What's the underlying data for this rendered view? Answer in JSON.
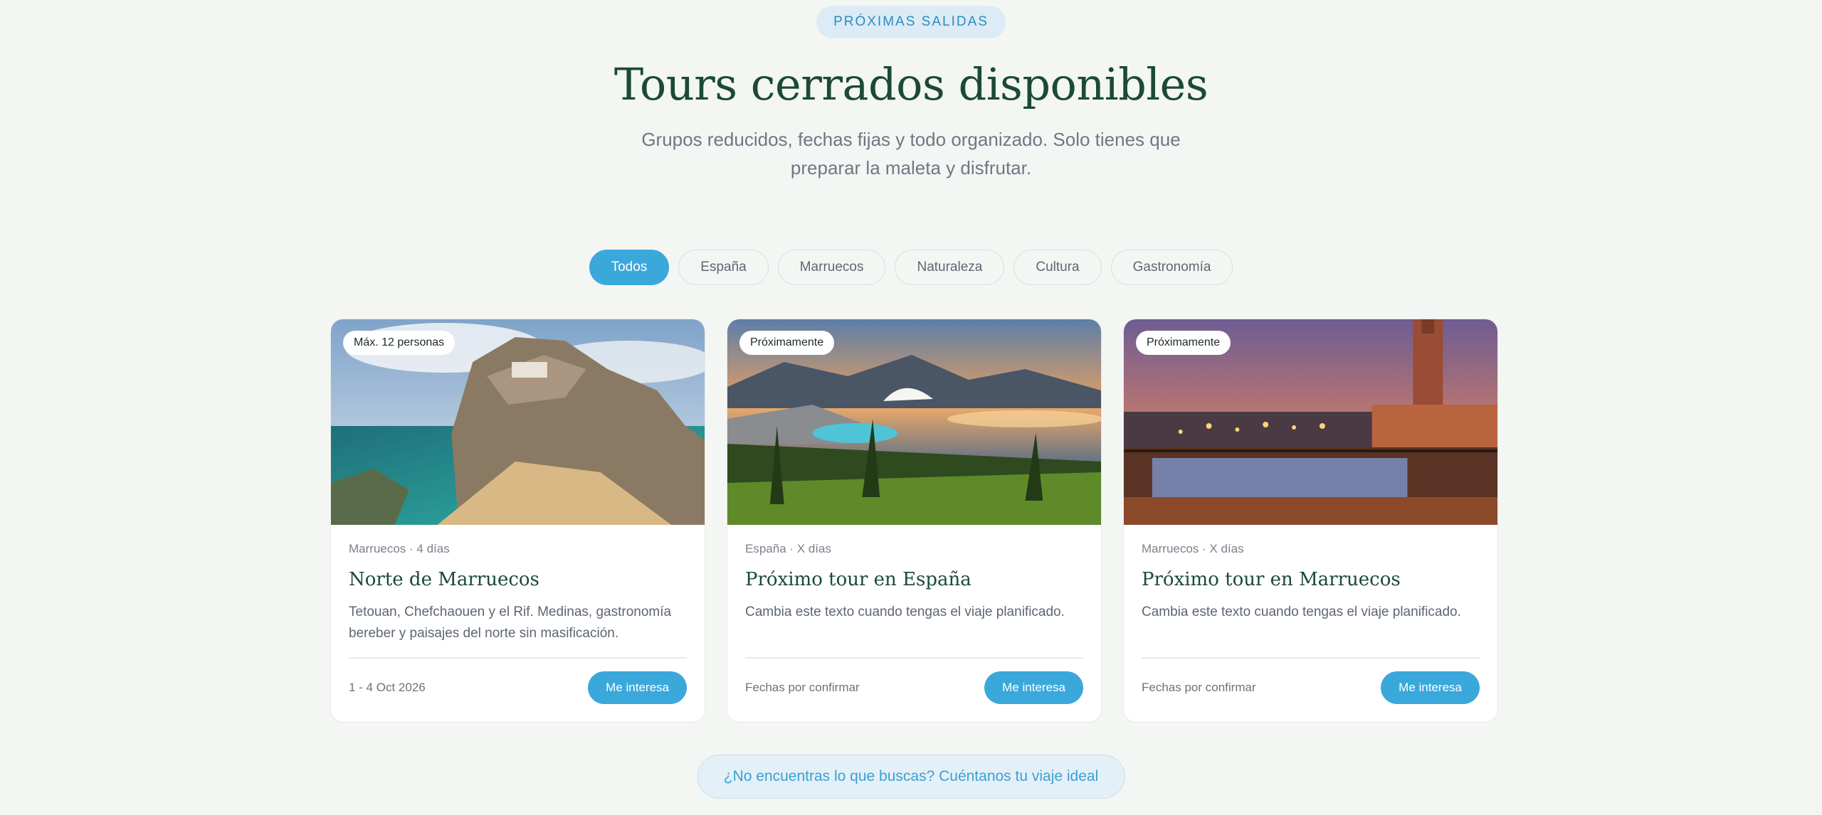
{
  "header": {
    "eyebrow": "PRÓXIMAS SALIDAS",
    "title": "Tours cerrados disponibles",
    "subtitle": "Grupos reducidos, fechas fijas y todo organizado. Solo tienes que preparar la maleta y disfrutar."
  },
  "filters": [
    {
      "label": "Todos",
      "active": true
    },
    {
      "label": "España",
      "active": false
    },
    {
      "label": "Marruecos",
      "active": false
    },
    {
      "label": "Naturaleza",
      "active": false
    },
    {
      "label": "Cultura",
      "active": false
    },
    {
      "label": "Gastronomía",
      "active": false
    }
  ],
  "cards": [
    {
      "badge": "Máx. 12 personas",
      "image": "coastal-cliff-town-photo",
      "meta": "Marruecos · 4 días",
      "title": "Norte de Marruecos",
      "description": "Tetouan, Chefchaouen y el Rif. Medinas, gastronomía bereber y paisajes del norte sin masificación.",
      "date": "1 - 4 Oct 2026",
      "button": "Me interesa"
    },
    {
      "badge": "Próximamente",
      "image": "sunset-coast-palms-photo",
      "meta": "España · X días",
      "title": "Próximo tour en España",
      "description": "Cambia este texto cuando tengas el viaje planificado.",
      "date": "Fechas por confirmar",
      "button": "Me interesa"
    },
    {
      "badge": "Próximamente",
      "image": "marrakech-square-dusk-photo",
      "meta": "Marruecos · X días",
      "title": "Próximo tour en Marruecos",
      "description": "Cambia este texto cuando tengas el viaje planificado.",
      "date": "Fechas por confirmar",
      "button": "Me interesa"
    }
  ],
  "cta": "¿No encuentras lo que buscas? Cuéntanos tu viaje ideal",
  "colors": {
    "accent": "#3ba8dc",
    "heading": "#1b4a36",
    "background": "#f4f6f3"
  }
}
